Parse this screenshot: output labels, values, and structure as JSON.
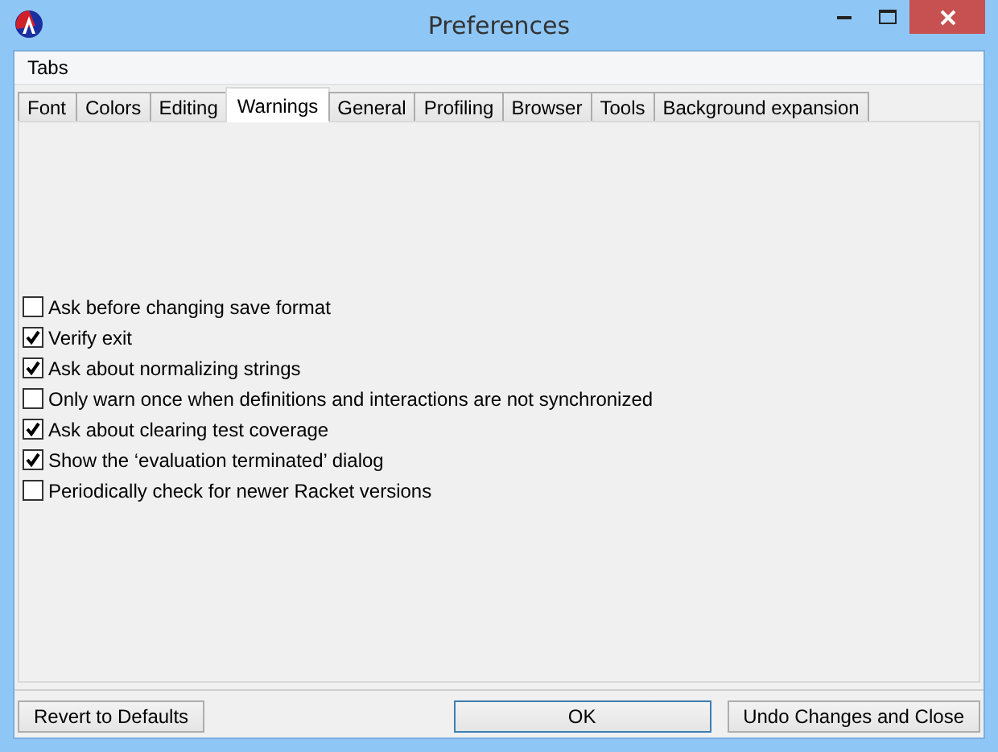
{
  "window": {
    "title": "Preferences"
  },
  "menu": [
    "Tabs"
  ],
  "tabs": [
    {
      "label": "Font",
      "selected": false
    },
    {
      "label": "Colors",
      "selected": false
    },
    {
      "label": "Editing",
      "selected": false
    },
    {
      "label": "Warnings",
      "selected": true
    },
    {
      "label": "General",
      "selected": false
    },
    {
      "label": "Profiling",
      "selected": false
    },
    {
      "label": "Browser",
      "selected": false
    },
    {
      "label": "Tools",
      "selected": false
    },
    {
      "label": "Background expansion",
      "selected": false
    }
  ],
  "options": [
    {
      "label": "Ask before changing save format",
      "checked": false
    },
    {
      "label": "Verify exit",
      "checked": true
    },
    {
      "label": "Ask about normalizing strings",
      "checked": true
    },
    {
      "label": "Only warn once when definitions and interactions are not synchronized",
      "checked": false
    },
    {
      "label": "Ask about clearing test coverage",
      "checked": true
    },
    {
      "label": "Show the ‘evaluation terminated’ dialog",
      "checked": true
    },
    {
      "label": "Periodically check for newer Racket versions",
      "checked": false
    }
  ],
  "buttons": [
    {
      "label": "Revert to Defaults",
      "kind": "left"
    },
    {
      "label": "OK",
      "kind": "default"
    },
    {
      "label": "Undo Changes and Close",
      "kind": "normal"
    }
  ]
}
